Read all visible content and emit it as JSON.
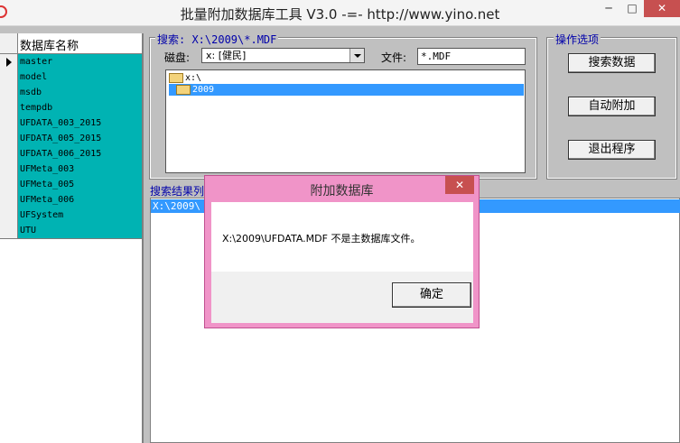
{
  "window": {
    "title": "批量附加数据库工具 V3.0   -=-   http://www.yino.net",
    "controls": {
      "minimize": "─",
      "maximize": "□",
      "close": "✕"
    }
  },
  "grid": {
    "header": "数据库名称",
    "rows": [
      "master",
      "model",
      "msdb",
      "tempdb",
      "UFDATA_003_2015",
      "UFDATA_005_2015",
      "UFDATA_006_2015",
      "UFMeta_003",
      "UFMeta_005",
      "UFMeta_006",
      "UFSystem",
      "UTU"
    ],
    "cell_color": "#00b3b3"
  },
  "search": {
    "group_label": "搜索: X:\\2009\\*.MDF",
    "disk_label": "磁盘:",
    "disk_value": "x: [健民]",
    "file_label": "文件:",
    "file_value": "*.MDF",
    "tree": [
      {
        "label": "x:\\",
        "selected": false
      },
      {
        "label": "2009",
        "selected": true
      }
    ]
  },
  "options": {
    "group_label": "操作选项",
    "search_button": "搜索数据",
    "attach_button": "自动附加",
    "exit_button": "退出程序"
  },
  "results": {
    "label": "搜索结果列",
    "row": "X:\\2009\\"
  },
  "dialog": {
    "title": "附加数据库",
    "close": "✕",
    "message": "X:\\2009\\UFDATA.MDF 不是主数据库文件。",
    "ok_button": "确定",
    "frame_color": "#f094c8"
  }
}
